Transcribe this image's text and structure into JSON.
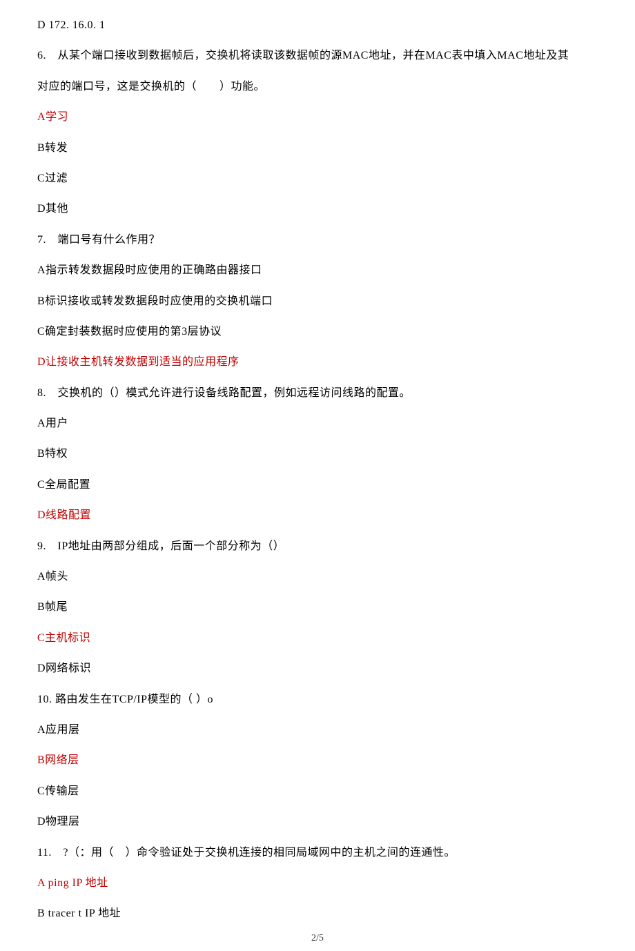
{
  "preamble": "D 172. 16.0. 1",
  "q6": {
    "stem1": "6.　从某个端口接收到数据帧后，交换机将读取该数据帧的源MAC地址，并在MAC表中填入MAC地址及其",
    "stem2": "对应的端口号，这是交换机的（　　）功能。",
    "A": "A学习",
    "B": "B转发",
    "C": "C过滤",
    "D": "D其他"
  },
  "q7": {
    "stem": "7.　端口号有什么作用？",
    "A": "A指示转发数据段时应使用的正确路由器接口",
    "B": "B标识接收或转发数据段时应使用的交换机端口",
    "C": "C确定封装数据时应使用的第3层协议",
    "D": "D让接收主机转发数据到适当的应用程序"
  },
  "q8": {
    "stem": "8.　交换机的（）模式允许进行设备线路配置，例如远程访问线路的配置。",
    "A": "A用户",
    "B": "B特权",
    "C": "C全局配置",
    "D": "D线路配置"
  },
  "q9": {
    "stem": "9.　IP地址由两部分组成，后面一个部分称为（）",
    "A": "A帧头",
    "B": "B帧尾",
    "C": "C主机标识",
    "D": "D网络标识"
  },
  "q10": {
    "stem": "10. 路由发生在TCP/IP模型的（ ）o",
    "A": "A应用层",
    "B": "B网络层",
    "C": "C传输层",
    "D": "D物理层"
  },
  "q11": {
    "stem": "11.　?（：用（　）命令验证处于交换机连接的相同局域网中的主机之间的连通性。",
    "A": "A ping IP 地址",
    "B": "B tracer t IP 地址"
  },
  "page_number": "2/5"
}
